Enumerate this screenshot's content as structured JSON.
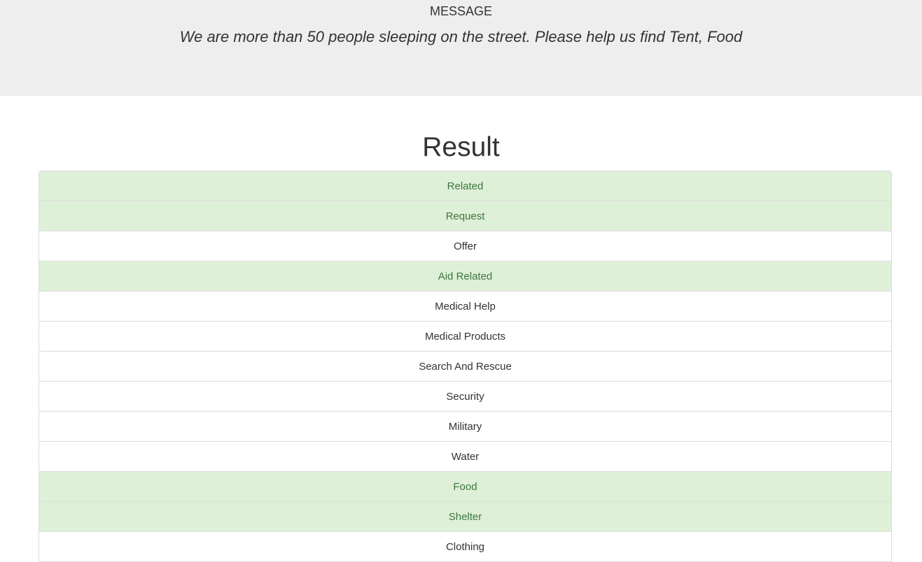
{
  "message": {
    "label": "MESSAGE",
    "text": "We are more than 50 people sleeping on the street. Please help us find Tent, Food"
  },
  "result": {
    "title": "Result",
    "categories": [
      {
        "label": "Related",
        "positive": true
      },
      {
        "label": "Request",
        "positive": true
      },
      {
        "label": "Offer",
        "positive": false
      },
      {
        "label": "Aid Related",
        "positive": true
      },
      {
        "label": "Medical Help",
        "positive": false
      },
      {
        "label": "Medical Products",
        "positive": false
      },
      {
        "label": "Search And Rescue",
        "positive": false
      },
      {
        "label": "Security",
        "positive": false
      },
      {
        "label": "Military",
        "positive": false
      },
      {
        "label": "Water",
        "positive": false
      },
      {
        "label": "Food",
        "positive": true
      },
      {
        "label": "Shelter",
        "positive": true
      },
      {
        "label": "Clothing",
        "positive": false
      }
    ]
  },
  "colors": {
    "positive_bg": "#dff0d8",
    "positive_text": "#3c763d",
    "header_bg": "#eeeeee"
  }
}
